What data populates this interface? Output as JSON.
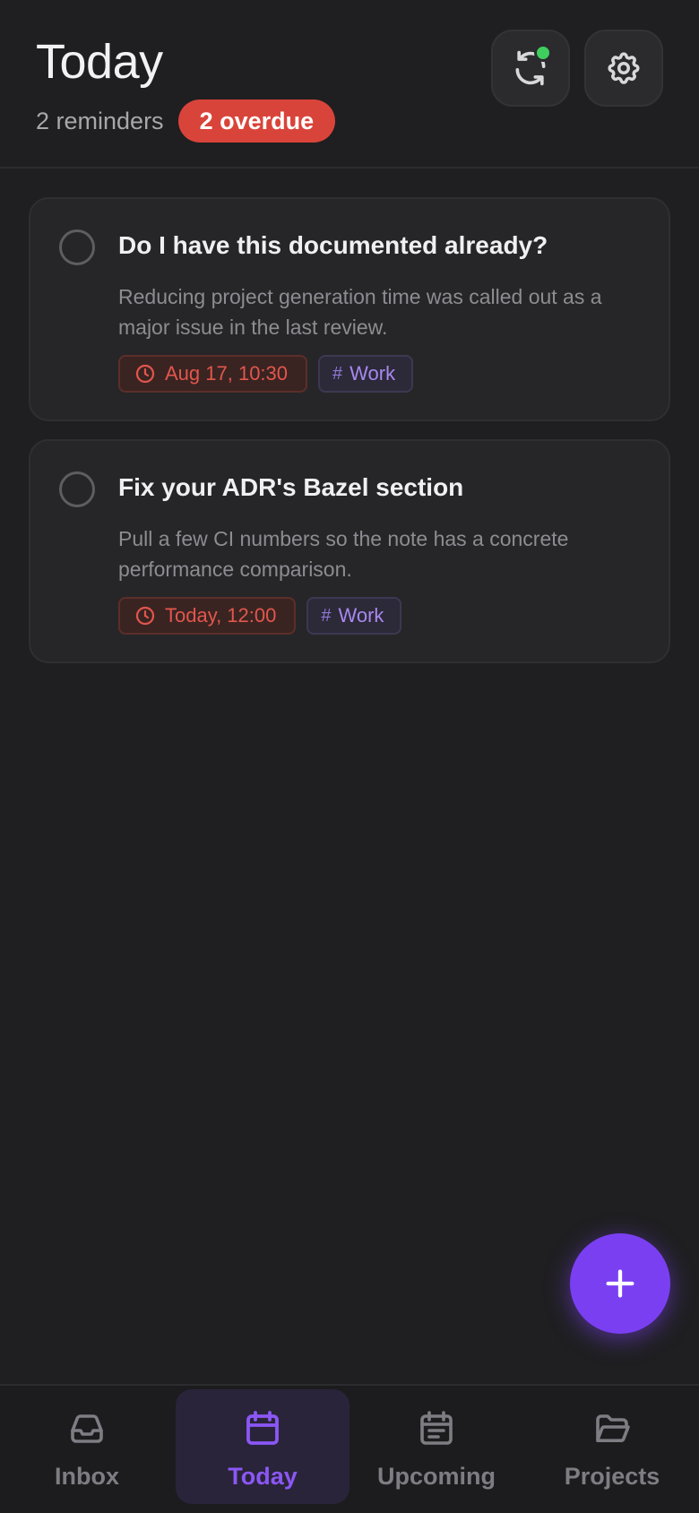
{
  "header": {
    "title": "Today",
    "count_text": "2 reminders",
    "overdue_badge": "2 overdue",
    "sync_icon": "sync-icon",
    "sync_status_color": "#3ecf5e",
    "settings_icon": "gear-icon"
  },
  "reminders": [
    {
      "title": "Do I have this documented already?",
      "description": "Reducing project generation time was called out as a major issue in the last review.",
      "due": "Aug 17, 10:30",
      "project": "Work",
      "overdue": true
    },
    {
      "title": "Fix your ADR's Bazel section",
      "description": "Pull a few CI numbers so the note has a concrete performance comparison.",
      "due": "Today, 12:00",
      "project": "Work",
      "overdue": true
    }
  ],
  "fab": {
    "icon": "plus-icon"
  },
  "nav": {
    "items": [
      {
        "label": "Inbox",
        "icon": "inbox-icon",
        "active": false
      },
      {
        "label": "Today",
        "icon": "calendar-icon",
        "active": true
      },
      {
        "label": "Upcoming",
        "icon": "calendar-list-icon",
        "active": false
      },
      {
        "label": "Projects",
        "icon": "folder-icon",
        "active": false
      }
    ]
  },
  "colors": {
    "accent": "#7b3ff2",
    "overdue": "#d9443a",
    "tag_text": "#a888ee",
    "background": "#1f1f21"
  }
}
